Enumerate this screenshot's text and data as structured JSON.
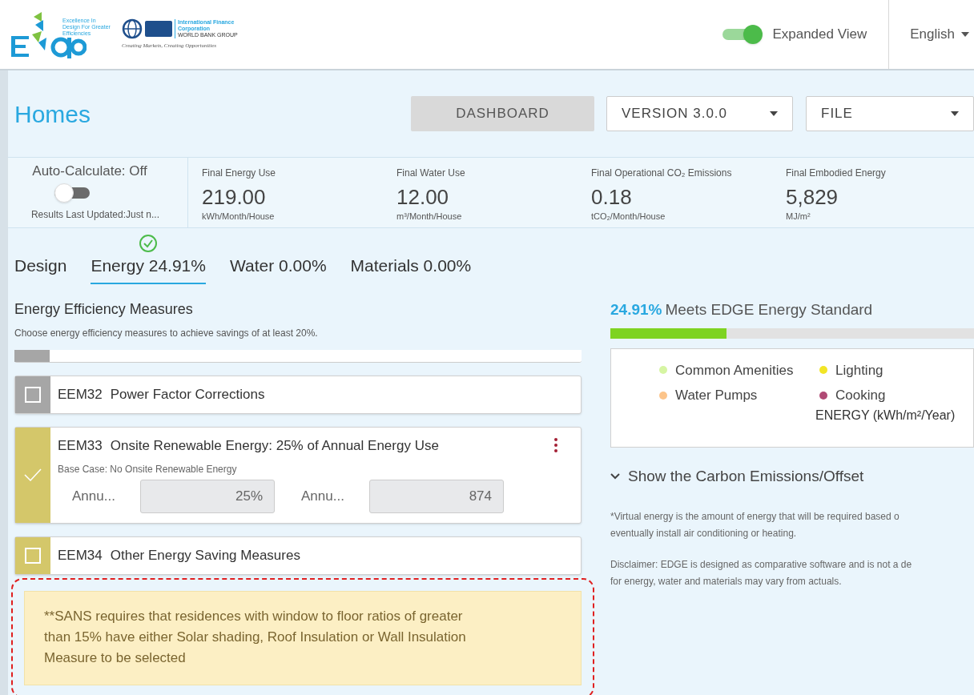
{
  "header": {
    "logo_text": "Excellence In Design For Greater Efficiencies",
    "partner_name": "International Finance Corporation",
    "partner_sub": "WORLD BANK GROUP",
    "partner_tagline": "Creating Markets, Creating Opportunities",
    "expanded_view": {
      "label": "Expanded View",
      "on": true
    },
    "language": "English"
  },
  "page": {
    "title": "Homes",
    "buttons": [
      {
        "label": "DASHBOARD",
        "kind": "button"
      },
      {
        "label": "VERSION 3.0.0",
        "kind": "dropdown"
      },
      {
        "label": "FILE",
        "kind": "dropdown"
      }
    ]
  },
  "summary": {
    "auto_calculate": {
      "label": "Auto-Calculate: Off",
      "on": false,
      "updated": "Results Last Updated:Just n..."
    },
    "metrics": [
      {
        "label": "Final Energy Use",
        "value": "219.00",
        "unit": "kWh/Month/House"
      },
      {
        "label": "Final Water Use",
        "value": "12.00",
        "unit": "m³/Month/House"
      },
      {
        "label": "Final Operational CO₂ Emissions",
        "value": "0.18",
        "unit": "tCO₂/Month/House"
      },
      {
        "label": "Final Embodied Energy",
        "value": "5,829",
        "unit": "MJ/m²"
      }
    ]
  },
  "tabs": [
    {
      "label": "Design",
      "selected": false,
      "complete": false
    },
    {
      "label": "Energy 24.91%",
      "selected": true,
      "complete": true
    },
    {
      "label": "Water 0.00%",
      "selected": false,
      "complete": false
    },
    {
      "label": "Materials 0.00%",
      "selected": false,
      "complete": false
    }
  ],
  "measures": {
    "title": "Energy Efficiency Measures",
    "subtitle": "Choose energy efficiency measures to achieve savings of at least 20%.",
    "items": [
      {
        "code": "EEM32",
        "name": "Power Factor Corrections",
        "checked": false,
        "color": "#a6a6a6"
      },
      {
        "code": "EEM33",
        "name": "Onsite Renewable Energy: 25% of Annual Energy Use",
        "checked": true,
        "color": "#d4c76a",
        "base_case": "Base Case: No Onsite Renewable Energy",
        "fields": [
          {
            "label": "Annu...",
            "value": "25%"
          },
          {
            "label": "Annu...",
            "value": "874"
          }
        ]
      },
      {
        "code": "EEM34",
        "name": "Other Energy Saving Measures",
        "checked": false,
        "color": "#d4c76a"
      }
    ],
    "note": "**SANS requires that residences with window to floor ratios of greater than 15% have either Solar shading, Roof Insulation or Wall Insulation Measure to be selected"
  },
  "standard": {
    "percent": "24.91%",
    "label": "Meets EDGE Energy Standard",
    "level": 0.32
  },
  "legend": {
    "items": [
      {
        "label": "Common Amenities",
        "color": "#d6f5a3"
      },
      {
        "label": "Lighting",
        "color": "#f2e526"
      },
      {
        "label": "Water Pumps",
        "color": "#fcc48a"
      },
      {
        "label": "Cooking",
        "color": "#b04a75"
      }
    ],
    "axis_label": "ENERGY (kWh/m²/Year)"
  },
  "carbon_toggle": {
    "label": "Show the Carbon Emissions/Offset",
    "expanded": false
  },
  "footnotes": [
    "*Virtual energy is the amount of energy that will be required based o",
    "eventually install air conditioning or heating.",
    "Disclaimer: EDGE is designed as comparative software and is not a de",
    "for energy, water and materials may vary from actuals."
  ]
}
